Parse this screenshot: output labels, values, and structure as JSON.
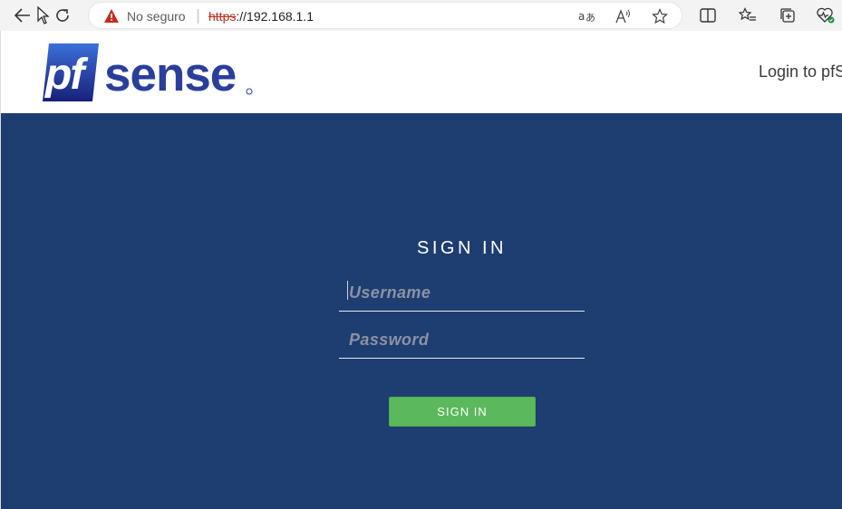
{
  "browser": {
    "insecure_label": "No seguro",
    "url_scheme": "https",
    "url_rest": "://192.168.1.1"
  },
  "header": {
    "logo_text": "pfsense",
    "title": "Login to pfSense"
  },
  "login": {
    "heading": "SIGN IN",
    "username_placeholder": "Username",
    "password_placeholder": "Password",
    "submit_label": "SIGN IN"
  },
  "colors": {
    "login_bg": "#1e3d71",
    "button_green": "#5cb85c",
    "logo_blue": "#2a3e9c"
  }
}
